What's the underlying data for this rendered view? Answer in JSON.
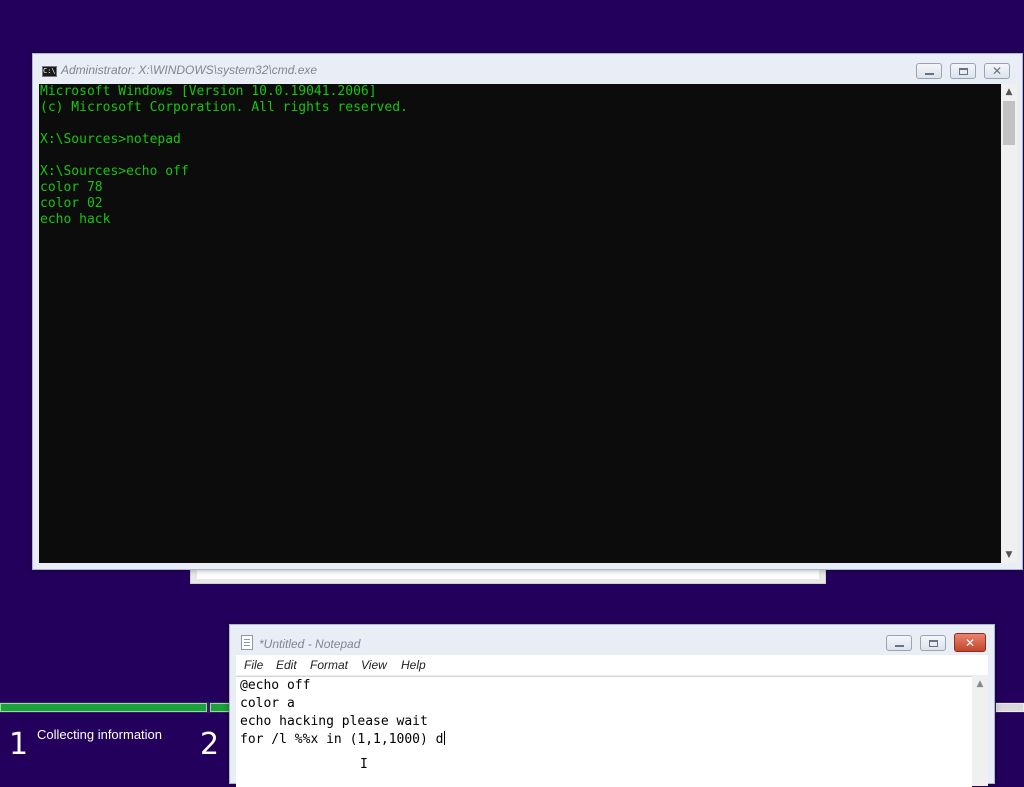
{
  "cmd": {
    "title": "Administrator: X:\\WINDOWS\\system32\\cmd.exe",
    "icon": "cmd-icon",
    "icon_glyph": "C:\\",
    "lines": [
      "Microsoft Windows [Version 10.0.19041.2006]",
      "(c) Microsoft Corporation. All rights reserved.",
      "",
      "X:\\Sources>notepad",
      "",
      "X:\\Sources>echo off",
      "color 78",
      "color 02",
      "echo hack"
    ],
    "text_color": "#16c60c",
    "background_color": "#0c0c0c",
    "scroll_up": "▲",
    "scroll_down": "▼"
  },
  "notepad": {
    "title": "*Untitled - Notepad",
    "menu": [
      "File",
      "Edit",
      "Format",
      "View",
      "Help"
    ],
    "lines": [
      "@echo off",
      "color a",
      "echo hacking please wait",
      "for /l %%x in (1,1,1000) d"
    ],
    "scroll_up": "▲"
  },
  "setup": {
    "steps": [
      {
        "number": "1",
        "label": "Collecting information"
      },
      {
        "number": "2",
        "label": ""
      }
    ],
    "progress_color": "#1aa33a",
    "background_color": "#23005c"
  },
  "window_controls": {
    "close": "✕"
  },
  "cursor": {
    "glyph": "I"
  }
}
